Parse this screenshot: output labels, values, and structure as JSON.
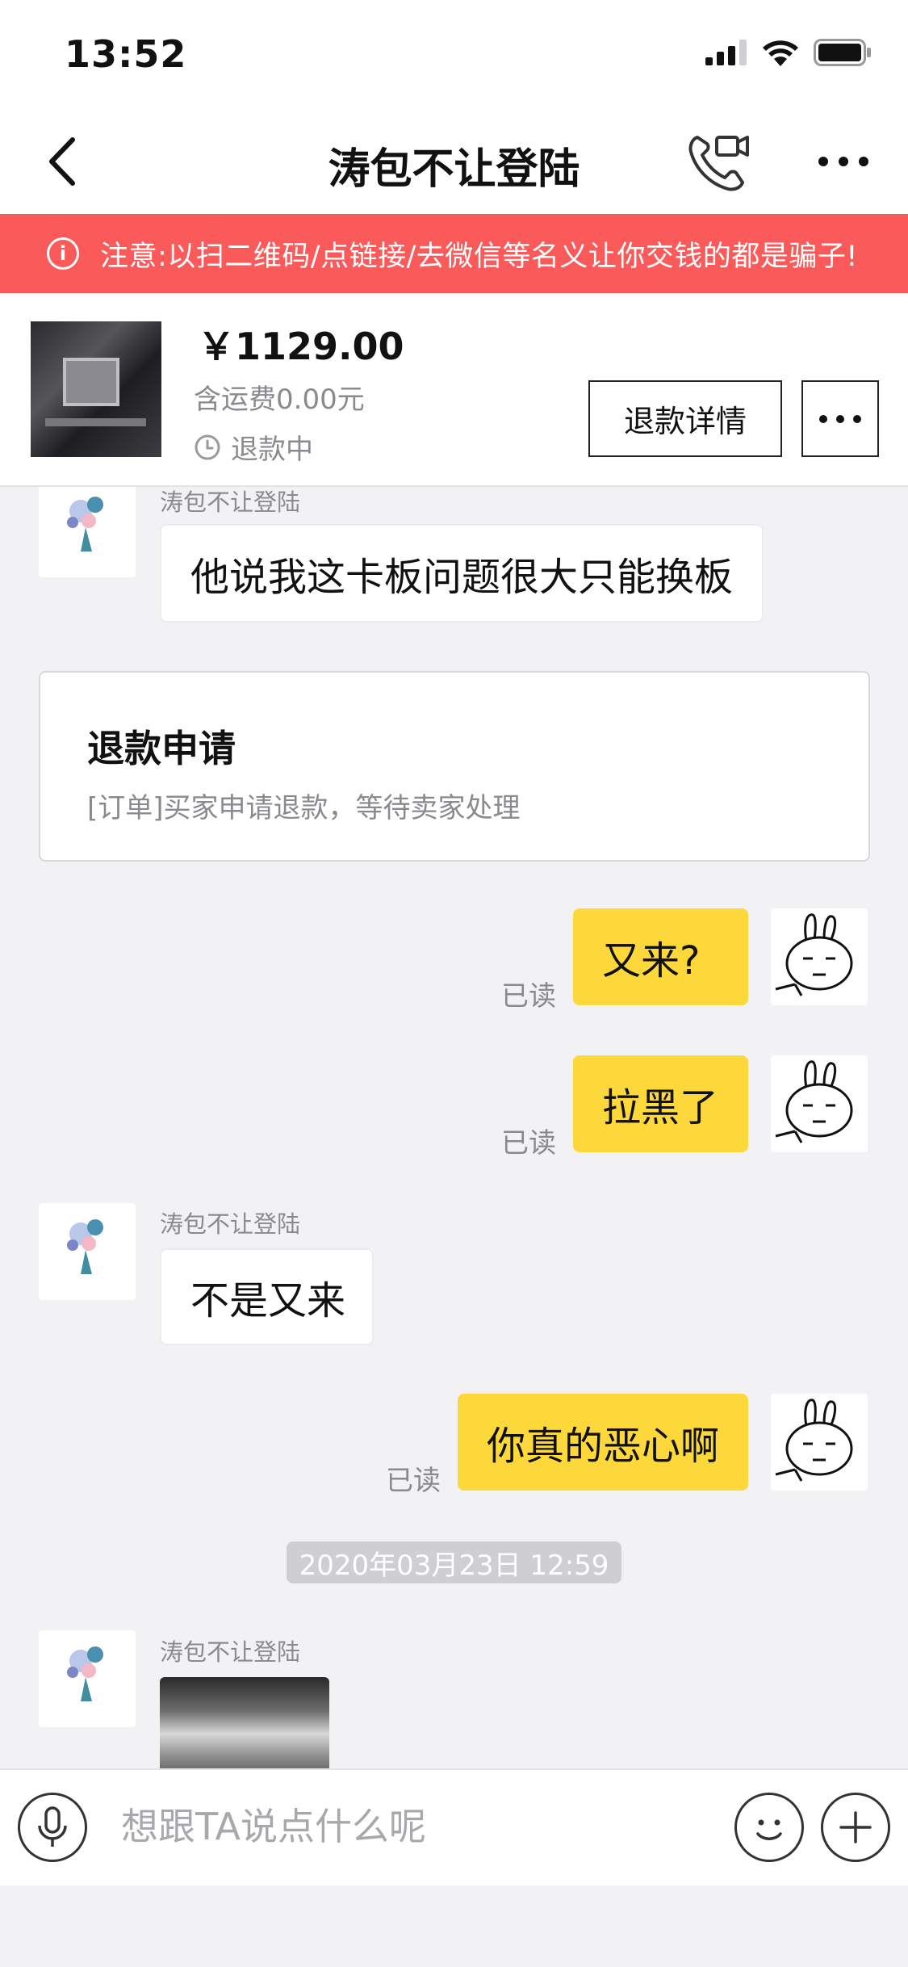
{
  "status_bar": {
    "time": "13:52"
  },
  "nav": {
    "title": "涛包不让登陆"
  },
  "warning": {
    "text": "注意:以扫二维码/点链接/去微信等名义让你交钱的都是骗子!"
  },
  "product": {
    "price": "￥1129.00",
    "shipping": "含运费0.00元",
    "status": "退款中",
    "refund_button": "退款详情"
  },
  "messages": {
    "m1": {
      "sender": "涛包不让登陆",
      "text": "他说我这卡板问题很大只能换板"
    },
    "refund_card": {
      "title": "退款申请",
      "desc": "[订单]买家申请退款，等待卖家处理"
    },
    "m2": {
      "text": "又来?",
      "read": "已读"
    },
    "m3": {
      "text": "拉黑了",
      "read": "已读"
    },
    "m4": {
      "sender": "涛包不让登陆",
      "text": "不是又来"
    },
    "m5": {
      "text": "你真的恶心啊",
      "read": "已读"
    },
    "timestamp": "2020年03月23日 12:59",
    "m6": {
      "sender": "涛包不让登陆"
    }
  },
  "input": {
    "placeholder": "想跟TA说点什么呢"
  }
}
